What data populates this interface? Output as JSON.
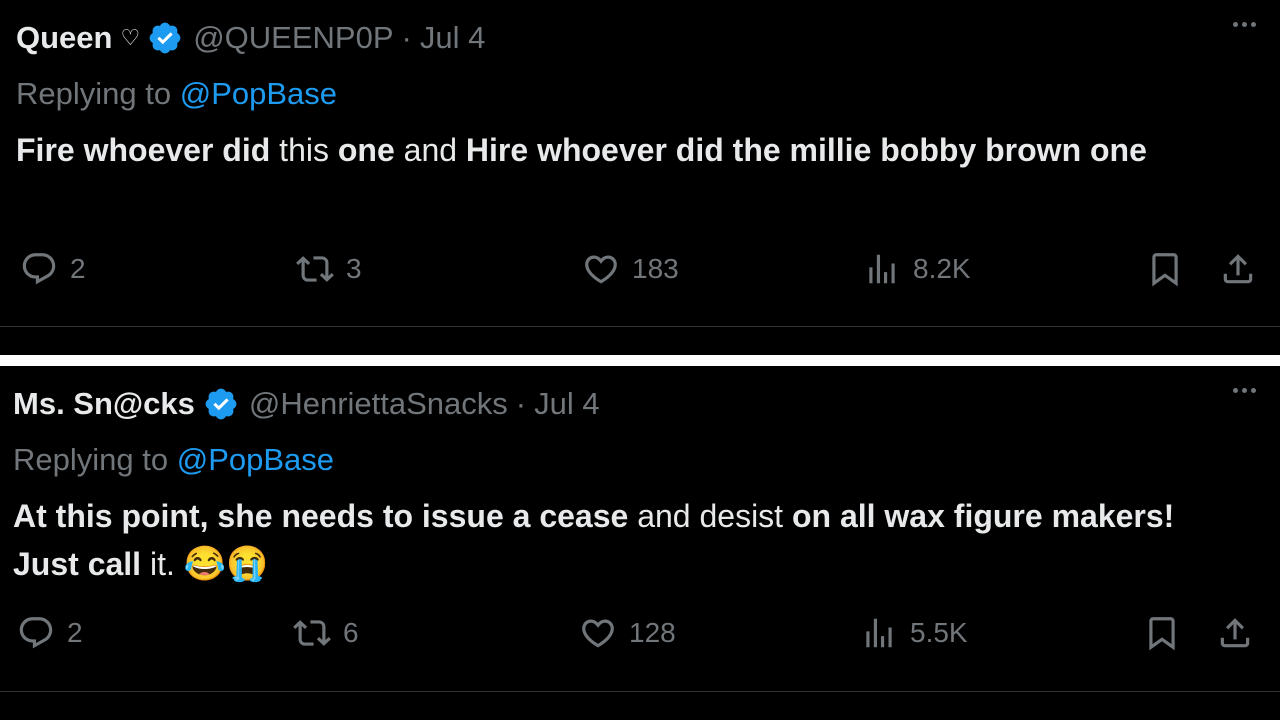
{
  "tweets": [
    {
      "name": "Queen",
      "name_mark": "♡",
      "handle": "@QUEENP0P",
      "separator": "·",
      "date": "Jul 4",
      "replying_to_label": "Replying to",
      "replying_to_handle": "@PopBase",
      "text_segments": [
        "Fire whoever did",
        " this ",
        "one",
        " and ",
        "Hire whoever did the millie bobby brown one"
      ],
      "stats": {
        "replies": "2",
        "reposts": "3",
        "likes": "183",
        "views": "8.2K"
      }
    },
    {
      "name": "Ms. Sn@cks",
      "handle": "@HenriettaSnacks",
      "separator": "·",
      "date": "Jul 4",
      "replying_to_label": "Replying to",
      "replying_to_handle": "@PopBase",
      "text_segments": [
        "At this point, she needs to issue a cease",
        " and desist ",
        "on all wax figure makers! Just call",
        " it. "
      ],
      "emojis": [
        "😂",
        "😭"
      ],
      "stats": {
        "replies": "2",
        "reposts": "6",
        "likes": "128",
        "views": "5.5K"
      }
    }
  ],
  "icons": {
    "verified": "verified-badge-icon",
    "more": "more-horizontal-icon",
    "reply": "reply-icon",
    "repost": "repost-icon",
    "like": "heart-icon",
    "views": "views-icon",
    "bookmark": "bookmark-icon",
    "share": "share-icon"
  },
  "colors": {
    "background": "#000000",
    "text": "#e7e9ea",
    "secondary": "#71767b",
    "accent": "#1d9bf0",
    "divider": "#2f3336"
  }
}
